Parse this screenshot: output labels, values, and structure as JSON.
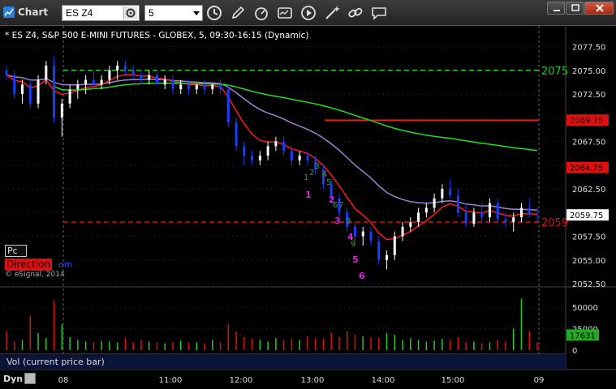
{
  "window": {
    "title": "Chart",
    "symbol_value": "ES Z4",
    "interval_value": "5"
  },
  "toolbar": {
    "icons": [
      "clock-icon",
      "pencil-icon",
      "speedometer-icon",
      "indicator-icon",
      "play-icon",
      "wand-icon",
      "link-icon",
      "chat-icon"
    ]
  },
  "chart": {
    "description": "* ES Z4, S&P 500 E-MINI FUTURES - GLOBEX, 5, 09:30-16:15 (Dynamic)",
    "copyright": "© eSignal, 2014",
    "legend_pc": "Pc",
    "legend_direction": "Direction",
    "legend_direction_tail": "om",
    "volume_title": "Vol (current price bar)",
    "dyn_label": "Dyn",
    "x_ticks": [
      "08",
      "11:00",
      "12:00",
      "13:00",
      "14:00",
      "15:00",
      "09"
    ],
    "price_ticks": [
      "2077.50",
      "2075.00",
      "2072.50",
      "2070.00",
      "2067.50",
      "2065.00",
      "2062.50",
      "2060.00",
      "2057.50",
      "2055.00",
      "2052.50"
    ],
    "volume_ticks": [
      "50000",
      "25000",
      "0"
    ],
    "level_labels": {
      "upper_green": "2075",
      "lower_red": "2059",
      "red_box_1": "2069.75",
      "red_box_2": "2064.75",
      "current_price": "2059.75",
      "volume_current": "17631"
    },
    "annotations": {
      "magenta": [
        "1",
        "2",
        "3",
        "4",
        "5",
        "6"
      ],
      "green": [
        "1",
        "2",
        "3",
        "4",
        "5",
        "6",
        "7",
        "8",
        "9"
      ]
    },
    "colors": {
      "bull": "#ffffff",
      "bear": "#1a3cff",
      "upper_dash": "#22cc22",
      "lower_dash": "#e01010",
      "ma_red": "#ff1a1a",
      "ma_purple": "#a080d0",
      "vwap_green": "#22dd22",
      "magenta": "#e020e0",
      "green_count": "#22aa22"
    }
  },
  "chart_data": {
    "type": "candlestick",
    "title": "* ES Z4, S&P 500 E-MINI FUTURES - GLOBEX, 5, 09:30-16:15 (Dynamic)",
    "xlabel": "",
    "ylabel": "",
    "ylim": [
      2052.5,
      2079.0
    ],
    "x_ticks": [
      "08",
      "11:00",
      "12:00",
      "13:00",
      "14:00",
      "15:00",
      "09"
    ],
    "candles_ohlc": [
      [
        2075.0,
        2075.5,
        2074.0,
        2074.5
      ],
      [
        2074.5,
        2075.0,
        2072.0,
        2072.5
      ],
      [
        2072.5,
        2074.0,
        2071.5,
        2073.5
      ],
      [
        2073.5,
        2074.0,
        2071.0,
        2071.5
      ],
      [
        2071.5,
        2074.5,
        2071.0,
        2074.0
      ],
      [
        2074.0,
        2076.0,
        2073.5,
        2075.5
      ],
      [
        2075.5,
        2076.5,
        2069.5,
        2070.0
      ],
      [
        2070.0,
        2072.0,
        2068.0,
        2071.5
      ],
      [
        2071.5,
        2073.5,
        2071.0,
        2073.0
      ],
      [
        2073.0,
        2074.0,
        2072.0,
        2073.5
      ],
      [
        2073.5,
        2074.5,
        2072.5,
        2074.0
      ],
      [
        2074.0,
        2075.0,
        2073.0,
        2073.5
      ],
      [
        2073.5,
        2074.5,
        2073.0,
        2074.0
      ],
      [
        2074.0,
        2075.5,
        2073.5,
        2075.0
      ],
      [
        2075.0,
        2076.0,
        2074.0,
        2075.5
      ],
      [
        2075.5,
        2076.0,
        2074.5,
        2075.0
      ],
      [
        2075.0,
        2075.5,
        2074.0,
        2074.5
      ],
      [
        2074.5,
        2075.0,
        2073.5,
        2074.0
      ],
      [
        2074.0,
        2075.0,
        2073.5,
        2074.5
      ],
      [
        2074.5,
        2075.0,
        2073.5,
        2073.5
      ],
      [
        2073.5,
        2074.5,
        2073.0,
        2074.0
      ],
      [
        2074.0,
        2074.5,
        2072.5,
        2073.0
      ],
      [
        2073.0,
        2074.0,
        2072.5,
        2073.5
      ],
      [
        2073.5,
        2074.0,
        2072.5,
        2073.0
      ],
      [
        2073.0,
        2073.5,
        2072.5,
        2073.5
      ],
      [
        2073.5,
        2074.0,
        2072.5,
        2073.0
      ],
      [
        2073.0,
        2073.5,
        2072.5,
        2073.5
      ],
      [
        2073.5,
        2074.0,
        2072.5,
        2073.0
      ],
      [
        2073.0,
        2073.5,
        2069.0,
        2069.5
      ],
      [
        2069.5,
        2070.0,
        2066.5,
        2067.0
      ],
      [
        2067.0,
        2067.5,
        2065.0,
        2066.0
      ],
      [
        2066.0,
        2066.5,
        2065.0,
        2065.5
      ],
      [
        2065.5,
        2066.5,
        2065.0,
        2066.0
      ],
      [
        2066.0,
        2067.5,
        2065.5,
        2067.0
      ],
      [
        2067.0,
        2068.0,
        2066.5,
        2067.5
      ],
      [
        2067.5,
        2068.0,
        2066.0,
        2066.5
      ],
      [
        2066.5,
        2067.0,
        2065.0,
        2065.5
      ],
      [
        2065.5,
        2066.5,
        2065.0,
        2066.0
      ],
      [
        2066.0,
        2066.5,
        2065.0,
        2065.5
      ],
      [
        2065.5,
        2066.0,
        2064.0,
        2064.5
      ],
      [
        2064.5,
        2065.0,
        2062.5,
        2063.0
      ],
      [
        2063.0,
        2063.5,
        2061.0,
        2061.5
      ],
      [
        2061.5,
        2062.0,
        2059.5,
        2060.0
      ],
      [
        2060.0,
        2060.5,
        2058.0,
        2058.5
      ],
      [
        2058.5,
        2059.0,
        2057.0,
        2057.5
      ],
      [
        2057.5,
        2058.5,
        2056.5,
        2058.0
      ],
      [
        2058.0,
        2058.5,
        2056.5,
        2057.0
      ],
      [
        2057.0,
        2057.5,
        2054.5,
        2055.0
      ],
      [
        2055.0,
        2056.0,
        2054.0,
        2055.5
      ],
      [
        2055.5,
        2058.0,
        2055.0,
        2057.5
      ],
      [
        2057.5,
        2059.0,
        2057.0,
        2058.5
      ],
      [
        2058.5,
        2059.5,
        2058.0,
        2059.0
      ],
      [
        2059.0,
        2060.5,
        2058.5,
        2060.0
      ],
      [
        2060.0,
        2061.0,
        2059.5,
        2060.5
      ],
      [
        2060.5,
        2062.0,
        2060.0,
        2061.5
      ],
      [
        2061.5,
        2063.0,
        2061.0,
        2062.5
      ],
      [
        2062.5,
        2063.5,
        2061.5,
        2061.8
      ],
      [
        2061.8,
        2062.5,
        2059.5,
        2060.0
      ],
      [
        2060.0,
        2061.0,
        2058.5,
        2058.8
      ],
      [
        2058.8,
        2060.5,
        2058.5,
        2060.0
      ],
      [
        2060.0,
        2061.0,
        2059.0,
        2059.5
      ],
      [
        2059.5,
        2061.5,
        2059.0,
        2061.0
      ],
      [
        2061.0,
        2061.5,
        2059.0,
        2059.3
      ],
      [
        2059.3,
        2060.0,
        2058.5,
        2059.0
      ],
      [
        2059.0,
        2060.0,
        2058.0,
        2059.5
      ],
      [
        2059.5,
        2061.0,
        2059.0,
        2060.5
      ],
      [
        2060.5,
        2061.5,
        2059.5,
        2059.8
      ],
      [
        2059.8,
        2060.5,
        2059.0,
        2059.75
      ]
    ],
    "volume": [
      22000,
      10000,
      12000,
      40000,
      20000,
      14000,
      58000,
      30000,
      15000,
      12000,
      10000,
      9000,
      11000,
      10000,
      9000,
      14000,
      9000,
      12000,
      10000,
      9000,
      8000,
      9000,
      11000,
      9000,
      9000,
      8000,
      12000,
      9000,
      30000,
      22000,
      15000,
      13000,
      12000,
      10000,
      14000,
      12000,
      13000,
      12000,
      16000,
      14000,
      13000,
      20000,
      15000,
      22000,
      18000,
      16000,
      15000,
      14000,
      20000,
      18000,
      12000,
      14000,
      12000,
      10000,
      11000,
      13000,
      12000,
      15000,
      9000,
      10000,
      8000,
      9000,
      12000,
      10000,
      25000,
      60000,
      22000,
      9000
    ],
    "levels": {
      "upper_green": 2075,
      "lower_red": 2059,
      "red_box_top": 2069.75,
      "red_box_bottom": 2064.75,
      "current": 2059.75
    },
    "volume_current": 17631
  }
}
